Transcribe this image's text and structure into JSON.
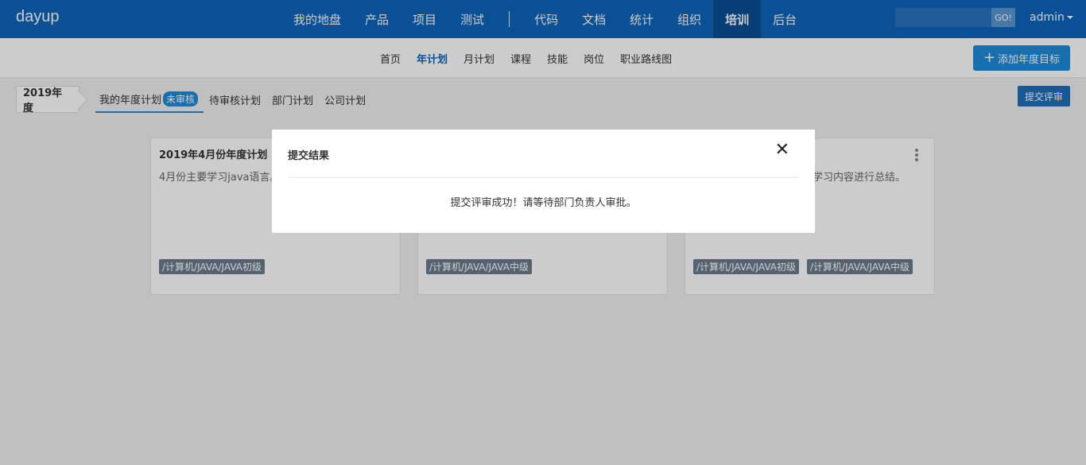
{
  "topbar": {
    "brand": "dayup",
    "nav": [
      "我的地盘",
      "产品",
      "项目",
      "测试"
    ],
    "nav2": [
      "代码",
      "文档",
      "统计",
      "组织",
      "培训",
      "后台"
    ],
    "active_nav": "培训",
    "search_button": "GO!",
    "user": "admin"
  },
  "subnav": {
    "items": [
      "首页",
      "年计划",
      "月计划",
      "课程",
      "技能",
      "岗位",
      "职业路线图"
    ],
    "active": "年计划",
    "add_button": "添加年度目标"
  },
  "toolbar": {
    "year": "2019年度",
    "tabs": [
      "我的年度计划",
      "待审核计划",
      "部门计划",
      "公司计划"
    ],
    "badge": "未审核",
    "submit_review": "提交评审"
  },
  "cards": [
    {
      "title": "2019年4月份年度计划",
      "desc": "4月份主要学习java语言。",
      "tags": [
        "/计算机/JAVA/JAVA初级"
      ]
    },
    {
      "title": "",
      "desc": "",
      "tags": [
        "/计算机/JAVA/JAVA中级"
      ]
    },
    {
      "title": "",
      "desc": "学习内容进行总结。",
      "tags": [
        "/计算机/JAVA/JAVA初级",
        "/计算机/JAVA/JAVA中级"
      ]
    }
  ],
  "modal": {
    "title": "提交结果",
    "close": "✕",
    "message": "提交评审成功！请等待部门负责人审批。"
  },
  "colors": {
    "topbar": "#0c64b9",
    "accent": "#1e8bd9",
    "tag": "#6b7b8c"
  }
}
